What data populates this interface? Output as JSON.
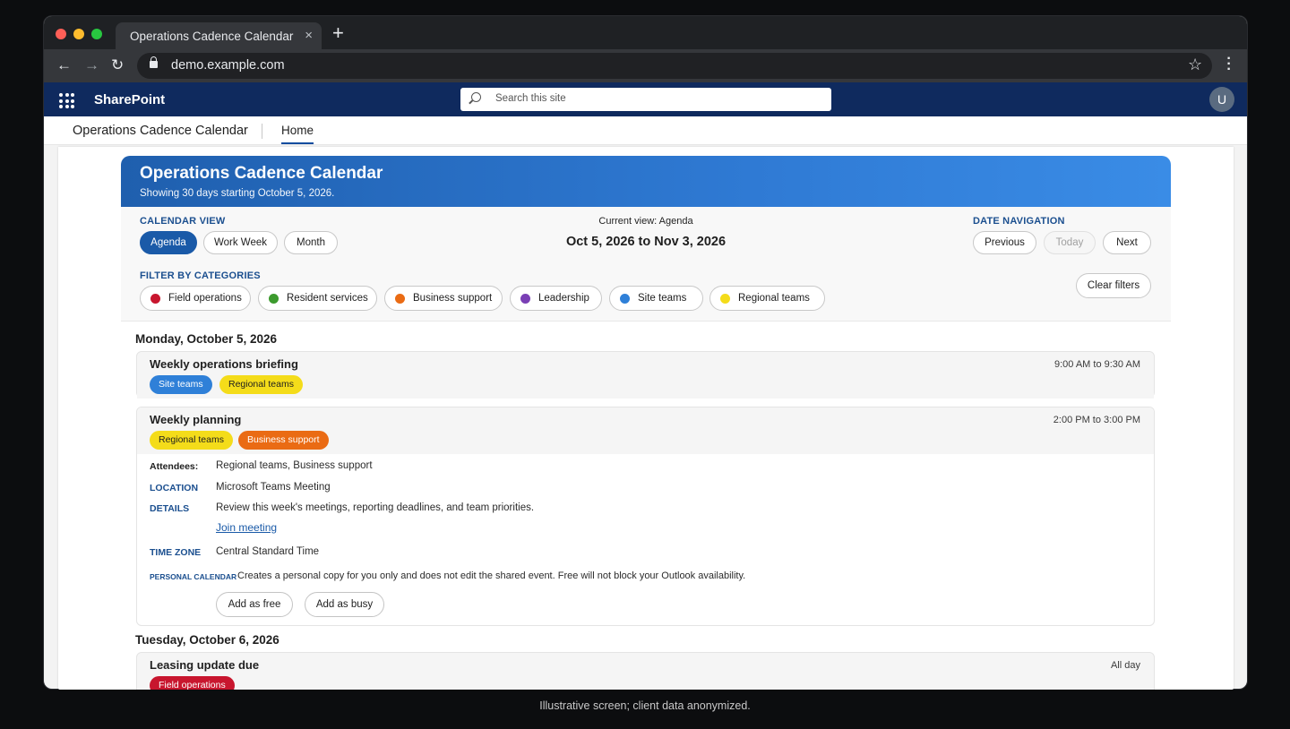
{
  "browser": {
    "tab_title": "Operations Cadence Calendar",
    "tab_close": "×",
    "new_tab": "+",
    "url": "demo.example.com"
  },
  "suite": {
    "brand": "SharePoint",
    "search_placeholder": "Search this site",
    "avatar_initial": "U"
  },
  "site": {
    "name": "Operations Cadence Calendar",
    "nav_home": "Home"
  },
  "banner": {
    "title": "Operations Cadence Calendar",
    "subtitle": "Showing 30 days starting October 5, 2026."
  },
  "calendar_view": {
    "label": "CALENDAR VIEW",
    "options": [
      "Agenda",
      "Work Week",
      "Month"
    ],
    "selected": "Agenda"
  },
  "current_view": {
    "label": "Current view: Agenda",
    "range": "Oct 5, 2026 to Nov 3, 2026"
  },
  "date_navigation": {
    "label": "DATE NAVIGATION",
    "previous": "Previous",
    "today": "Today",
    "next": "Next"
  },
  "filters": {
    "label": "FILTER BY CATEGORIES",
    "clear": "Clear filters",
    "categories": [
      {
        "name": "Field operations",
        "color": "#c8162e"
      },
      {
        "name": "Resident services",
        "color": "#3c9a2e"
      },
      {
        "name": "Business support",
        "color": "#ea6b14"
      },
      {
        "name": "Leadership",
        "color": "#7a3fb5"
      },
      {
        "name": "Site teams",
        "color": "#2f80d8"
      },
      {
        "name": "Regional teams",
        "color": "#f4dc1a"
      }
    ]
  },
  "days": [
    {
      "title": "Monday, October 5, 2026",
      "events": [
        {
          "title": "Weekly operations briefing",
          "time": "9:00 AM to 9:30 AM",
          "tags": [
            "Site teams",
            "Regional teams"
          ]
        },
        {
          "title": "Weekly planning",
          "time": "2:00 PM to 3:00 PM",
          "tags": [
            "Regional teams",
            "Business support"
          ],
          "attendees_label": "Attendees:",
          "attendees": "Regional teams, Business support",
          "location_label": "LOCATION",
          "location": "Microsoft Teams Meeting",
          "details_label": "DETAILS",
          "details": "Review this week's meetings, reporting deadlines, and team priorities.",
          "join_link": "Join meeting",
          "timezone_label": "TIME ZONE",
          "timezone": "Central Standard Time",
          "personal_label": "PERSONAL CALENDAR",
          "personal_note": "Creates a personal copy for you only and does not edit the shared event. Free will not block your Outlook availability.",
          "add_free": "Add as free",
          "add_busy": "Add as busy"
        }
      ]
    },
    {
      "title": "Tuesday, October 6, 2026",
      "events": [
        {
          "title": "Leasing update due",
          "time": "All day",
          "tags": [
            "Field operations"
          ]
        }
      ]
    }
  ],
  "caption": "Illustrative screen; client data anonymized."
}
